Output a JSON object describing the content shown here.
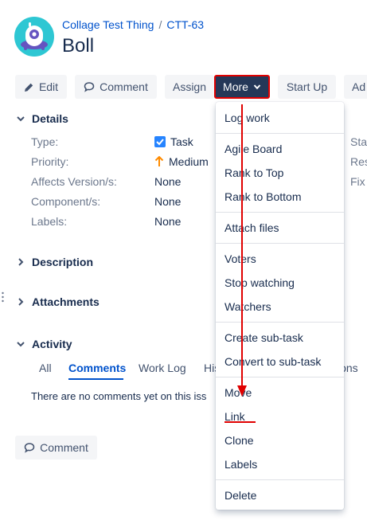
{
  "breadcrumb": {
    "project": "Collage Test Thing",
    "separator": "/",
    "issue_key": "CTT-63"
  },
  "issue": {
    "title": "Boll"
  },
  "toolbar": {
    "edit": "Edit",
    "comment": "Comment",
    "assign": "Assign",
    "more": "More",
    "start_up": "Start Up",
    "admin_truncated": "Ad"
  },
  "details": {
    "heading": "Details",
    "fields": [
      {
        "label": "Type:",
        "value": "Task"
      },
      {
        "label": "Priority:",
        "value": "Medium"
      },
      {
        "label": "Affects Version/s:",
        "value": "None"
      },
      {
        "label": "Component/s:",
        "value": "None"
      },
      {
        "label": "Labels:",
        "value": "None"
      }
    ],
    "side_labels": [
      "Stat",
      "Res",
      "Fix V"
    ]
  },
  "sections": {
    "description": "Description",
    "attachments": "Attachments",
    "activity": "Activity"
  },
  "activity": {
    "tabs": [
      "All",
      "Comments",
      "Work Log",
      "His",
      "ions"
    ],
    "active_tab": "Comments",
    "empty_message": "There are no comments yet on this iss"
  },
  "bottom": {
    "comment_button": "Comment"
  },
  "more_menu": {
    "groups": [
      [
        "Log work"
      ],
      [
        "Agile Board",
        "Rank to Top",
        "Rank to Bottom"
      ],
      [
        "Attach files"
      ],
      [
        "Voters",
        "Stop watching",
        "Watchers"
      ],
      [
        "Create sub-task",
        "Convert to sub-task"
      ],
      [
        "Move",
        "Link",
        "Clone",
        "Labels"
      ],
      [
        "Delete"
      ]
    ]
  },
  "colors": {
    "link": "#0052cc",
    "more_button_bg": "#253858",
    "annotation_red": "#e00000",
    "checkbox_blue": "#2684ff",
    "priority_orange": "#ff8b00",
    "avatar_teal": "#2ec7d3"
  },
  "icons": [
    "project-avatar-icon",
    "pencil-icon",
    "comment-bubble-icon",
    "chevron-down-icon",
    "checkbox-checked-icon",
    "arrow-up-icon"
  ]
}
